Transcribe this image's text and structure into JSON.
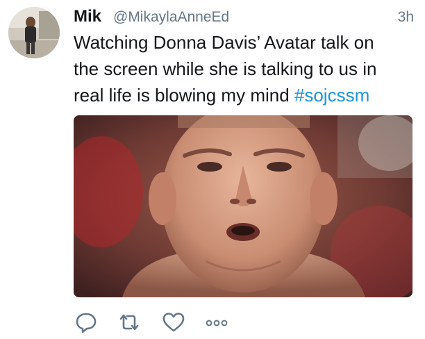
{
  "tweet": {
    "display_name": "Mik",
    "handle": "@MikaylaAnneEd",
    "timestamp": "3h",
    "text_lines": [
      "Watching Donna Davis’ Avatar talk on",
      "the screen while she is talking to us in",
      "real life is blowing my mind "
    ],
    "hashtag": "#sojcssm",
    "media_type": "image"
  },
  "actions": {
    "icons": [
      "reply-icon",
      "retweet-icon",
      "like-icon",
      "more-icon"
    ]
  },
  "colors": {
    "text": "#14171a",
    "secondary": "#657786",
    "link": "#1b95e0",
    "icon": "#657786"
  }
}
